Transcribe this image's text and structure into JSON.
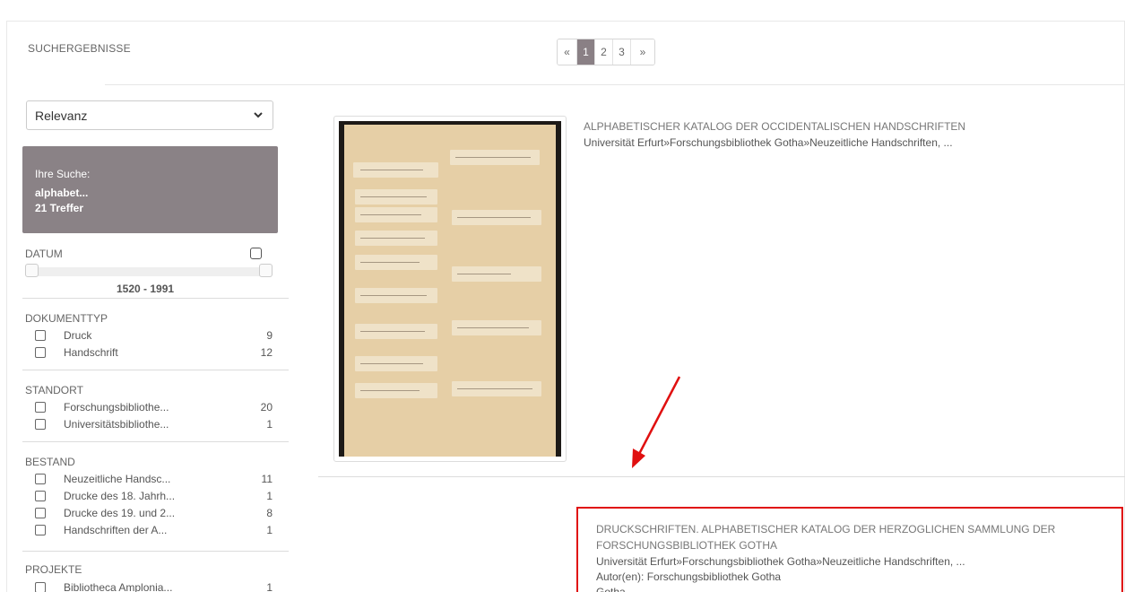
{
  "header": {
    "title": "SUCHERGEBNISSE"
  },
  "pagination": {
    "prev": "«",
    "pages": [
      "1",
      "2",
      "3"
    ],
    "active": "1",
    "next": "»"
  },
  "sort": {
    "selected": "Relevanz"
  },
  "search_box": {
    "label": "Ihre Suche:",
    "term": "alphabet...",
    "hits": "21 Treffer"
  },
  "date_facet": {
    "title": "DATUM",
    "range": "1520 - 1991"
  },
  "facets": [
    {
      "title": "DOKUMENTTYP",
      "items": [
        {
          "name": "Druck",
          "count": "9"
        },
        {
          "name": "Handschrift",
          "count": "12"
        }
      ]
    },
    {
      "title": "STANDORT",
      "items": [
        {
          "name": "Forschungsbibliothe...",
          "count": "20"
        },
        {
          "name": "Universitätsbibliothe...",
          "count": "1"
        }
      ]
    },
    {
      "title": "BESTAND",
      "items": [
        {
          "name": "Neuzeitliche Handsc...",
          "count": "11"
        },
        {
          "name": "Drucke des 18. Jahrh...",
          "count": "1"
        },
        {
          "name": "Drucke des 19. und 2...",
          "count": "8"
        },
        {
          "name": "Handschriften der A...",
          "count": "1"
        }
      ]
    },
    {
      "title": "PROJEKTE",
      "items": [
        {
          "name": "Bibliotheca Amplonia...",
          "count": "1"
        }
      ]
    }
  ],
  "results": [
    {
      "title": "ALPHABETISCHER KATALOG DER OCCIDENTALISCHEN HANDSCHRIFTEN",
      "path": "Universität Erfurt»Forschungsbibliothek Gotha»Neuzeitliche Handschriften, ..."
    },
    {
      "title_line1": "DRUCKSCHRIFTEN. ALPHABETISCHER KATALOG DER HERZOGLICHEN SAMMLUNG DER",
      "title_line2": "FORSCHUNGSBIBLIOTHEK GOTHA",
      "path": "Universität Erfurt»Forschungsbibliothek Gotha»Neuzeitliche Handschriften, ...",
      "author": "Autor(en): Forschungsbibliothek Gotha",
      "place": "Gotha"
    }
  ],
  "colors": {
    "accent": "#8a8286",
    "annotation": "#e01010"
  },
  "icons": {
    "sort": "chevron-down-icon",
    "annotation": "red-arrow-icon"
  }
}
